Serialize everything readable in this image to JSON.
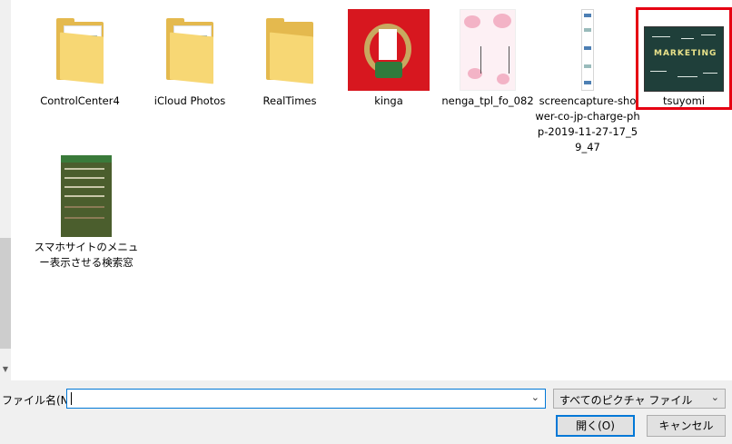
{
  "files": [
    {
      "name": "ControlCenter4",
      "type": "folder"
    },
    {
      "name": "iCloud Photos",
      "type": "folder"
    },
    {
      "name": "RealTimes",
      "type": "folder"
    },
    {
      "name": "kinga",
      "type": "image"
    },
    {
      "name": "nenga_tpl_fo_082",
      "type": "image"
    },
    {
      "name": "screencapture-shower-co-jp-charge-php-2019-11-27-17_59_47",
      "type": "image"
    },
    {
      "name": "tsuyomi",
      "type": "image",
      "selected": true,
      "thumb_text": "MARKETING"
    },
    {
      "name": "スマホサイトのメニュー表示させる検索窓",
      "type": "image"
    }
  ],
  "bottom": {
    "filename_label": "ファイル名(N):",
    "filename_value": "",
    "filter_value": "すべてのピクチャ ファイル",
    "open_label": "開く(O)",
    "cancel_label": "キャンセル"
  },
  "colors": {
    "selection": "#e60012",
    "accent": "#0078d7",
    "panel": "#f0f0f0"
  },
  "icons": [
    "folder-icon",
    "chevron-down-icon",
    "scroll-down-arrow-icon"
  ]
}
